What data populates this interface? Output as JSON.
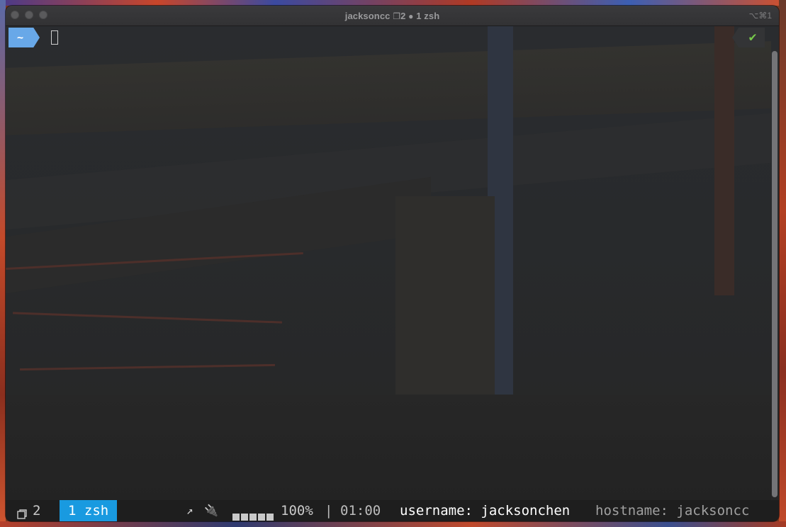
{
  "window": {
    "title": "jacksoncc",
    "title_session_count": "2",
    "title_window": "1 zsh",
    "shortcut": "⌥⌘1"
  },
  "prompt": {
    "directory": "~",
    "status_icon": "check-icon",
    "status_glyph": "✔"
  },
  "tmux": {
    "session_icon": "window-icon",
    "session_count": "2",
    "active_window": "1 zsh",
    "load_icon": "arrow-up-right-icon",
    "load_glyph": "↗",
    "power_icon": "plug-icon",
    "power_glyph": "🔌",
    "battery_level": 1.0,
    "battery_text": "100%",
    "separator": "|",
    "time": "01:00",
    "username": "username: jacksonchen",
    "hostname": "hostname: jacksoncc"
  },
  "colors": {
    "prompt_segment": "#68a8e8",
    "active_tab": "#199ae0",
    "check": "#76c84a",
    "status_bar": "#1e1e1e"
  }
}
